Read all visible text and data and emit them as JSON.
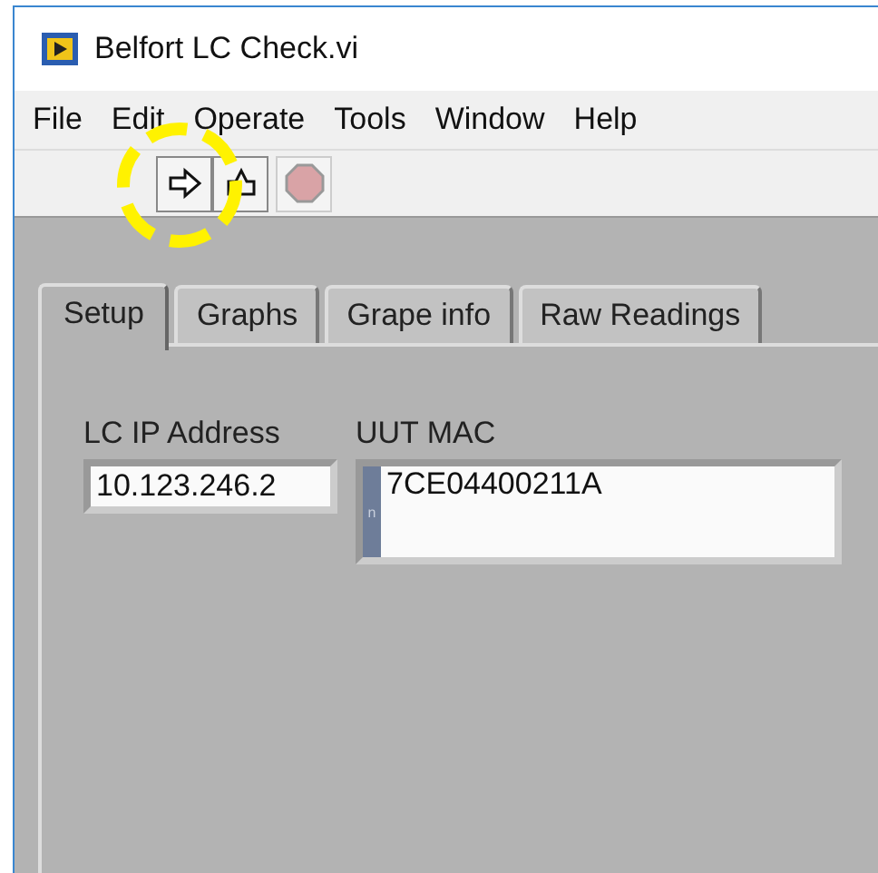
{
  "window": {
    "title": "Belfort LC Check.vi"
  },
  "menu": [
    "File",
    "Edit",
    "Operate",
    "Tools",
    "Window",
    "Help"
  ],
  "toolbar": {
    "run_disabled": false,
    "abort_disabled": true
  },
  "tabs": [
    {
      "label": "Setup",
      "selected": true
    },
    {
      "label": "Graphs",
      "selected": false
    },
    {
      "label": "Grape info",
      "selected": false
    },
    {
      "label": "Raw Readings",
      "selected": false
    }
  ],
  "fields": [
    {
      "label": "LC IP Address",
      "value": "10.123.246.2",
      "kind": "single"
    },
    {
      "label": "UUT MAC",
      "value": "7CE04400211A",
      "kind": "multi",
      "radix": "n"
    }
  ]
}
